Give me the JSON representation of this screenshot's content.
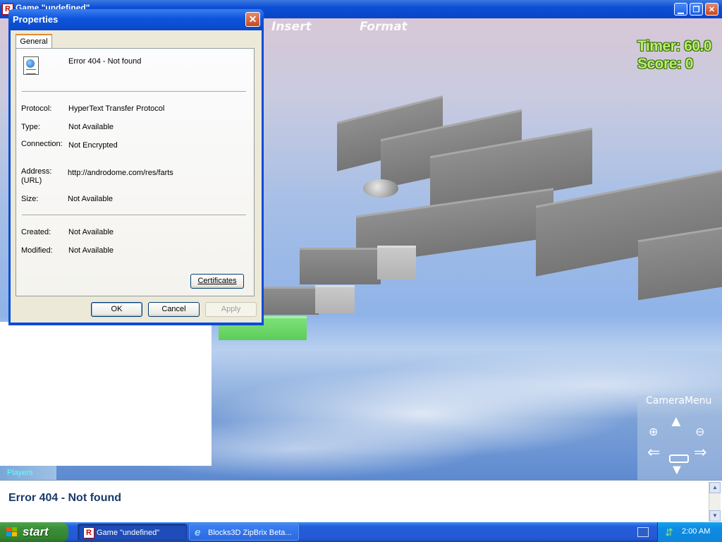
{
  "window": {
    "title": "Game \"undefined\"",
    "app_icon": "R",
    "minimize_glyph": "▁",
    "maximize_glyph": "❐",
    "close_glyph": "✕"
  },
  "game": {
    "menu": {
      "insert": "Insert",
      "format": "Format"
    },
    "hud": {
      "timer": "Timer: 60.0",
      "score": "Score: 0"
    },
    "players_tab": "Players",
    "camera_menu": {
      "title": "CameraMenu",
      "icons": [
        "zoom-in-icon",
        "pan-up-icon",
        "zoom-out-icon",
        "rotate-left-icon",
        "fit-view-icon",
        "rotate-right-icon",
        "pan-down-icon"
      ]
    },
    "message": "Error 404 - Not found"
  },
  "dialog": {
    "title": "Properties",
    "close_glyph": "✕",
    "tab": "General",
    "doc_title": "Error 404 - Not found",
    "fields": {
      "protocol_label": "Protocol:",
      "protocol_value": "HyperText Transfer Protocol",
      "type_label": "Type:",
      "type_value": "Not Available",
      "connection_label": "Connection:",
      "connection_value": "Not Encrypted",
      "address_label": "Address:",
      "address_label2": "(URL)",
      "address_value": "http://androdome.com/res/farts",
      "size_label": "Size:",
      "size_value": "Not Available",
      "created_label": "Created:",
      "created_value": "Not Available",
      "modified_label": "Modified:",
      "modified_value": "Not Available"
    },
    "buttons": {
      "certificates": "Certificates",
      "ok": "OK",
      "cancel": "Cancel",
      "apply": "Apply"
    }
  },
  "taskbar": {
    "start_label": "start",
    "tasks": [
      {
        "label": "Game \"undefined\"",
        "icon": "R"
      },
      {
        "label": "Blocks3D ZipBrix Beta...",
        "icon": "e"
      }
    ],
    "clock": "2:00 AM"
  }
}
